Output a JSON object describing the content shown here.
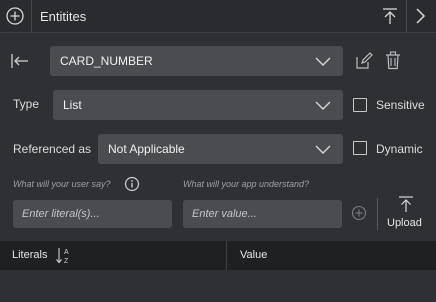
{
  "header": {
    "title": "Entitites"
  },
  "entity": {
    "name": "CARD_NUMBER"
  },
  "type_row": {
    "label": "Type",
    "value": "List",
    "checkbox_label": "Sensitive",
    "checked": false
  },
  "reference_row": {
    "label": "Referenced as",
    "value": "Not Applicable",
    "checkbox_label": "Dynamic",
    "checked": false
  },
  "literal": {
    "hint": "What will your user say?",
    "placeholder": "Enter literal(s)..."
  },
  "value": {
    "hint": "What will your app understand?",
    "placeholder": "Enter value..."
  },
  "upload": {
    "label": "Upload"
  },
  "table": {
    "columns": [
      "Literals",
      "Value"
    ]
  },
  "icons": {
    "add": "plus-circle-icon",
    "export": "export-icon",
    "collapse": "chevron-right-icon",
    "back": "arrow-left-bar-icon",
    "edit": "edit-icon",
    "delete": "trash-icon",
    "info": "info-icon",
    "sort": "sort-az-icon"
  },
  "colors": {
    "background": "#2f3033",
    "field": "#4a4c50",
    "table_header": "#1f2022"
  }
}
